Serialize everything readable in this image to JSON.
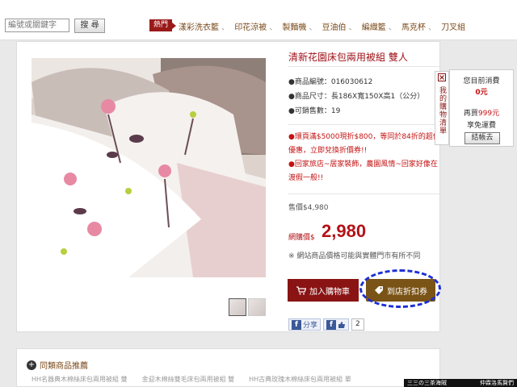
{
  "search": {
    "placeholder": "編號或關鍵字",
    "button": "搜 尋"
  },
  "hot": {
    "badge": "熱門",
    "links": [
      "漾彩洗衣籃",
      "印花涼被",
      "製麵機",
      "豆油伯",
      "編織籃",
      "馬克杯",
      "刀叉組"
    ]
  },
  "product": {
    "title": "清新花園床包兩用被組 雙人",
    "specs": [
      "●商品編號：016030612",
      "●商品尺寸：長186X寬150X高1（公分）",
      "●可銷售數：19"
    ],
    "promos": [
      "●環頁滿$5000現折$800，等同於84折的超值優惠，立即兌換折價券!!",
      "●回家旅店~居家裝飾，農園風情~回家好像在渡假一般!!"
    ],
    "list_price": "售價$4,980",
    "price_label": "網購價$",
    "price": "2,980",
    "note": "※ 網站商品價格可能與實體門市有所不同",
    "cart_button": "加入購物車",
    "coupon_button": "到店折扣券",
    "share_label": "分享",
    "share_count": "2"
  },
  "side_cart": {
    "tab_label": "我的購物清單",
    "spent_label": "您目前消費",
    "spent_value": "0元",
    "free_prefix": "再買",
    "free_amount": "999元",
    "free_suffix": "享免運費",
    "checkout": "結帳去"
  },
  "related": {
    "title": "同類商品推薦",
    "items": [
      "HH名器典木棉絲床包兩用被組 雙",
      "金迎木棉絲雙毛床包兩用被組 雙",
      "HH古典玫瑰木棉絲床包兩用被組 單"
    ]
  },
  "footer": {
    "left": "三三の三茶海賊",
    "right": "仲霖洛馬賢們"
  },
  "colors": {
    "brand_red": "#b31217",
    "hot_red": "#9a1a1a",
    "coupon_brown": "#7a5316",
    "highlight_blue": "#1c2fd6"
  }
}
